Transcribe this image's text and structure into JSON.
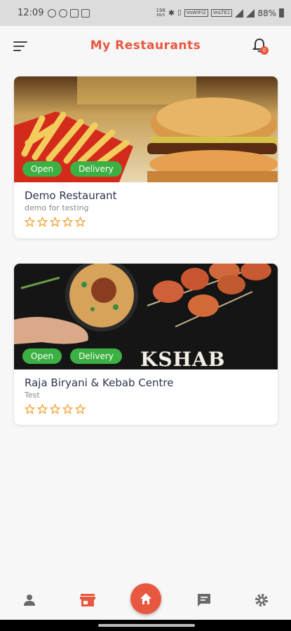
{
  "status_bar": {
    "time": "12:09",
    "data_rate": "198",
    "data_unit": "KB/S",
    "network_1": "VoWIFI2",
    "network_2": "VoLTE1",
    "battery": "88%"
  },
  "header": {
    "title": "My Restaurants",
    "notification_count": "0"
  },
  "restaurants": [
    {
      "name": "Demo Restaurant",
      "description": "demo for testing",
      "badges": [
        "Open",
        "Delivery"
      ],
      "rating": 0,
      "max_rating": 5
    },
    {
      "name": "Raja Biryani & Kebab Centre",
      "description": "Test",
      "badges": [
        "Open",
        "Delivery"
      ],
      "rating": 0,
      "max_rating": 5,
      "image_text": "KSHAB"
    }
  ],
  "bottom_nav": {
    "items": [
      "profile-icon",
      "store-icon",
      "home-icon",
      "chat-icon",
      "settings-icon"
    ],
    "active": "home-icon"
  },
  "colors": {
    "accent": "#e8573f",
    "badge": "#3cb043",
    "star": "#f0a030"
  }
}
